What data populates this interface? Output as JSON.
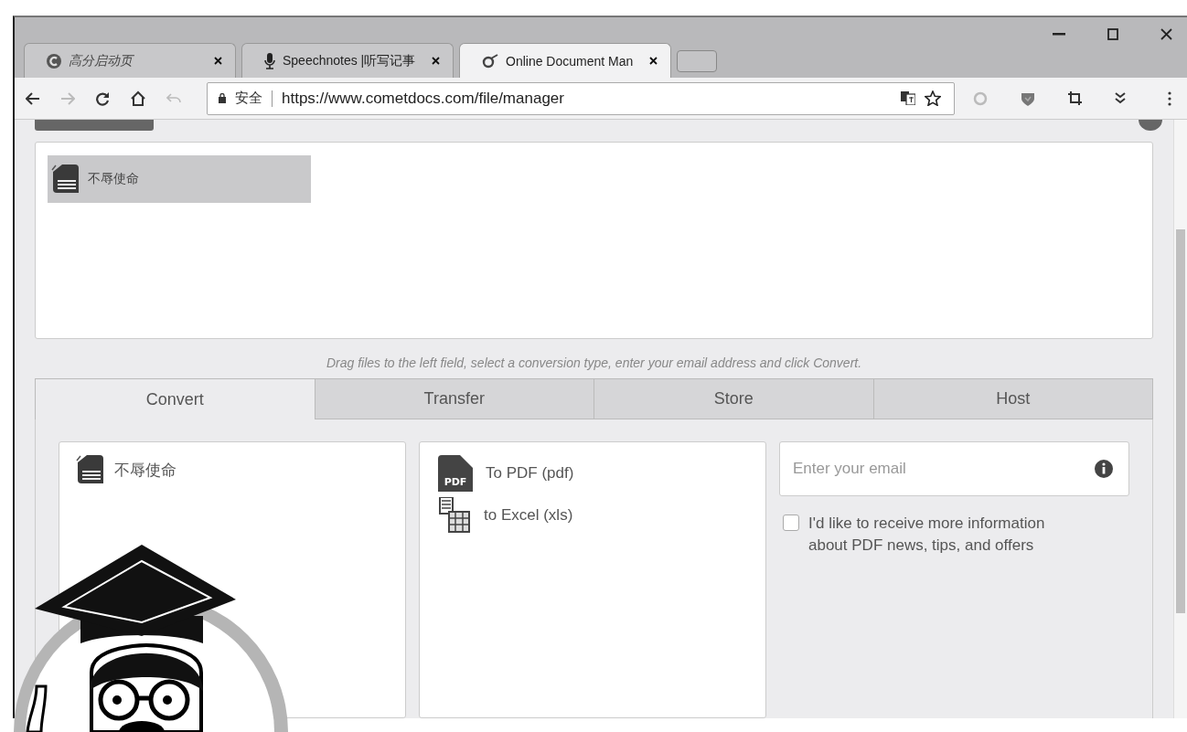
{
  "browser": {
    "tabs": [
      {
        "title": "高分启动页",
        "kind": "start",
        "selected": false
      },
      {
        "title": "Speechnotes |听写记事",
        "kind": "mic",
        "selected": false
      },
      {
        "title": "Online Document Man",
        "kind": "comet",
        "selected": true
      }
    ],
    "address": {
      "secure_label": "安全",
      "url": "https://www.cometdocs.com/file/manager"
    }
  },
  "upload_area": {
    "files": [
      {
        "name": "不辱使命",
        "selected": true
      }
    ]
  },
  "hint": "Drag files to the left field, select a conversion type, enter your email address and click Convert.",
  "service_tabs": [
    {
      "label": "Convert",
      "selected": true
    },
    {
      "label": "Transfer",
      "selected": false
    },
    {
      "label": "Store",
      "selected": false
    },
    {
      "label": "Host",
      "selected": false
    }
  ],
  "source_files": [
    {
      "name": "不辱使命"
    }
  ],
  "conversions": [
    {
      "label": "To PDF (pdf)",
      "kind": "pdf",
      "badge": "PDF"
    },
    {
      "label": "to Excel (xls)",
      "kind": "excel"
    }
  ],
  "email": {
    "placeholder": "Enter your email"
  },
  "newsletter": {
    "label": "I'd like to receive more information about PDF news, tips, and offers",
    "checked": false
  }
}
